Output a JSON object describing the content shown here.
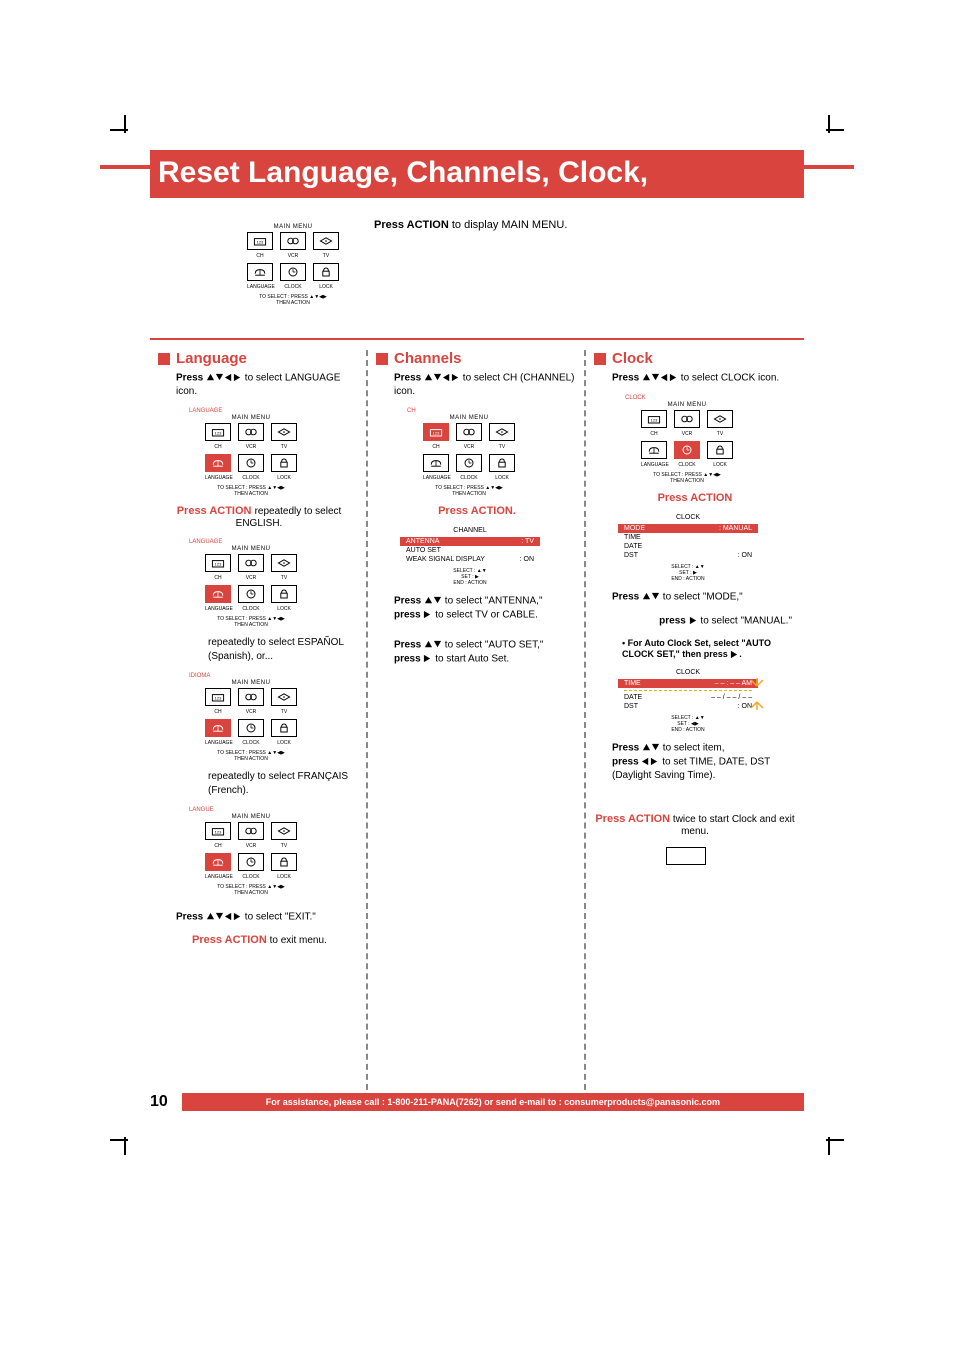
{
  "title": "Reset Language, Channels, Clock,",
  "intro": {
    "line1_a": "Press ACTION",
    "line1_b": " to display MAIN MENU.",
    "menu_label": "MAIN MENU",
    "icons_top": [
      "CH",
      "VCR",
      "TV"
    ],
    "icons_bottom": [
      "LANGUAGE",
      "CLOCK",
      "LOCK"
    ],
    "hint": "TO SELECT  : PRESS ▲▼◀▶\nTHEN ACTION"
  },
  "language": {
    "title": "Language",
    "instr1_a": "Press ",
    "instr1_b": " to select LANGUAGE icon.",
    "menus": [
      {
        "selected": "LANGUAGE",
        "selected_row": 1,
        "selected_col": 0
      },
      {
        "selected": "LANGUAGE",
        "selected_row": 1,
        "selected_col": 0,
        "label_sel": "IDIOMA"
      },
      {
        "selected": "LANGUAGE",
        "selected_row": 1,
        "selected_col": 0,
        "label_sel": "LANGUE"
      }
    ],
    "press_action": "Press ACTION",
    "repeat_a": "repeatedly to select ENGLISH.",
    "repeat_b": "repeatedly to select ESPAÑOL (Spanish), or...",
    "repeat_c": "repeatedly to select FRANÇAIS (French).",
    "instr_final_a": "Press ",
    "instr_final_b": " to select \"EXIT.\"",
    "exit": "Press ACTION",
    "exit_b": " to exit menu."
  },
  "channels": {
    "title": "Channels",
    "instr1_a": "Press ",
    "instr1_b": " to select CH (CHANNEL) icon.",
    "menu": {
      "selected": "CH",
      "selected_row": 0,
      "selected_col": 0
    },
    "press_action": "Press ACTION.",
    "sub_header": "CHANNEL",
    "sub_items": [
      {
        "label": "ANTENNA",
        "val": ": TV",
        "hl": true
      },
      {
        "label": "AUTO SET",
        "val": "",
        "hl": false
      },
      {
        "label": "WEAK SIGNAL DISPLAY",
        "val": ": ON",
        "hl": false
      }
    ],
    "sub_hint": "SELECT :  ▲▼\nSET       :  ▶\nEND       : ACTION",
    "step_a_1": "Press ",
    "step_a_2": " to select \"ANTENNA,\"",
    "step_a_3": "press ",
    "step_a_4": " to select TV or CABLE.",
    "step_b_1": "Press ",
    "step_b_2": " to select \"AUTO SET,\"",
    "step_b_3": "press ",
    "step_b_4": " to start Auto Set."
  },
  "clock": {
    "title": "Clock",
    "instr1_a": "Press ",
    "instr1_b": " to select CLOCK icon.",
    "menu": {
      "selected": "CLOCK",
      "selected_row": 1,
      "selected_col": 1
    },
    "press_action": "Press ACTION",
    "sub_header": "CLOCK",
    "sub_items": [
      {
        "label": "MODE",
        "val": ": MANUAL",
        "hl": true
      },
      {
        "label": "TIME",
        "val": "",
        "hl": false
      },
      {
        "label": "DATE",
        "val": "",
        "hl": false
      },
      {
        "label": "DST",
        "val": ": ON",
        "hl": false
      }
    ],
    "sub_hint": "SELECT :  ▲▼\nSET       :  ▶\nEND       : ACTION",
    "step_a_1": "Press ",
    "step_a_2": " to select \"MODE,\"",
    "step_a_3": "press ",
    "step_a_4": " to select \"MANUAL.\"",
    "note1": "• For Auto Clock Set, select \"AUTO CLOCK SET,\" then press ",
    "clockset_header": "CLOCK",
    "clockset_rows": [
      {
        "label": "TIME",
        "val": "– – : – – AM",
        "hl": true
      },
      {
        "label": "DATE",
        "val": "– – / – – / – –",
        "hl": false
      },
      {
        "label": "DST",
        "val": ": ON",
        "hl": false
      }
    ],
    "clockset_hint": "SELECT :  ▲▼\nSET       :  ◀▶\nEND       : ACTION",
    "step_b_1": "Press ",
    "step_b_2": " to select item,",
    "step_b_3": "press ",
    "step_b_4": " to set TIME, DATE, DST (Daylight Saving Time).",
    "exit_1": "Press ACTION",
    "exit_2": " twice to start Clock and exit menu."
  },
  "footer": {
    "page": "10",
    "text": "For assistance, please call : 1-800-211-PANA(7262) or send e-mail to : consumerproducts@panasonic.com"
  }
}
